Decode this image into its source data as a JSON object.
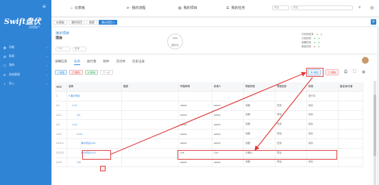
{
  "app": {
    "logo": "Swift盘伏",
    "logo_sub": "试用账户"
  },
  "sidebar": {
    "items": [
      {
        "icon": "▦",
        "label": "功能"
      },
      {
        "icon": "▤",
        "label": "报表"
      },
      {
        "icon": "▢",
        "label": "我的"
      },
      {
        "icon": "⚙",
        "label": "系统管理"
      },
      {
        "icon": "⇪",
        "label": "导入"
      }
    ]
  },
  "topbar": {
    "nav": [
      {
        "icon": "⌂",
        "label": "仪表板"
      },
      {
        "icon": "⊳",
        "label": "我的流程"
      },
      {
        "icon": "▤",
        "label": "我的项目"
      },
      {
        "icon": "☰",
        "label": "我的任务"
      }
    ],
    "search_placeholder": "项目",
    "search_scope": "项目",
    "bell_icon": "☆",
    "user_icon": "◎"
  },
  "tabs": [
    {
      "label": "仪表板"
    },
    {
      "label": "我的项目"
    },
    {
      "label": "搜索"
    },
    {
      "label": "演示项目 ×"
    }
  ],
  "project": {
    "title": "演示项目",
    "subtitle": "项目",
    "select1": "TOP",
    "select2": "菜单",
    "progress_pct": "23%",
    "progress_label": "进行中",
    "stats": [
      {
        "label": "已完成任务",
        "color": "green"
      },
      {
        "label": "计划任务",
        "color": "green"
      },
      {
        "label": "逾期任务",
        "color": "green"
      },
      {
        "label": "剩余任务",
        "color": "red"
      }
    ]
  },
  "detail_tabs": [
    "详细信息",
    "任务",
    "执行者",
    "附件",
    "交付件",
    "历史记录"
  ],
  "toolbar": {
    "add": "+ 添加",
    "delete": "▤ 删除",
    "move": "▣ 移动",
    "more": "下一步",
    "right_add": "⊕ 添加",
    "right_delete": "▤ 删除"
  },
  "grid": {
    "headers": [
      "WBS",
      "名称",
      "描述",
      "开始时间",
      "负责人",
      "项目状态",
      "项目任务",
      "状态",
      "备注/执行者"
    ],
    "rows": [
      {
        "wbs": "1",
        "name": "▾ 演示项目",
        "start": "",
        "owner": "",
        "status": "",
        "task": "",
        "state": "进行中"
      },
      {
        "wbs": "1.1",
        "name": "▾ 11",
        "start": "admin",
        "owner": "admin",
        "status": "流程",
        "task": "任务",
        "state": "待办"
      },
      {
        "wbs": "1.1.1",
        "name": "111",
        "start": "admin",
        "owner": "admin",
        "status": "流程",
        "task": "项目",
        "state": "待办"
      },
      {
        "wbs": "1.2",
        "name": "▾ 12",
        "start": "admin",
        "owner": "admin",
        "status": "流程",
        "task": "任务",
        "state": "待办"
      },
      {
        "wbs": "1.2.1",
        "name": "▾ 121",
        "start": "admin",
        "owner": "admin",
        "status": "流程",
        "task": "项目",
        "state": "待办"
      },
      {
        "wbs": "1.2.1.1",
        "name": "演示项目1211",
        "start": "admin",
        "owner": "admin",
        "status": "流程",
        "task": "任务",
        "state": "待办"
      },
      {
        "wbs": "1.2.1.2",
        "name": "演示项目1212",
        "start": "Lee",
        "owner": "Curl",
        "status": "已确认",
        "task": "项目",
        "state": ""
      },
      {
        "wbs": "1.2.2",
        "name": "122",
        "start": "admin",
        "owner": "admin",
        "status": "流程",
        "task": "项目",
        "state": "待办"
      }
    ]
  },
  "colors": {
    "accent": "#2f84d6",
    "annotation": "#e03b3b"
  }
}
